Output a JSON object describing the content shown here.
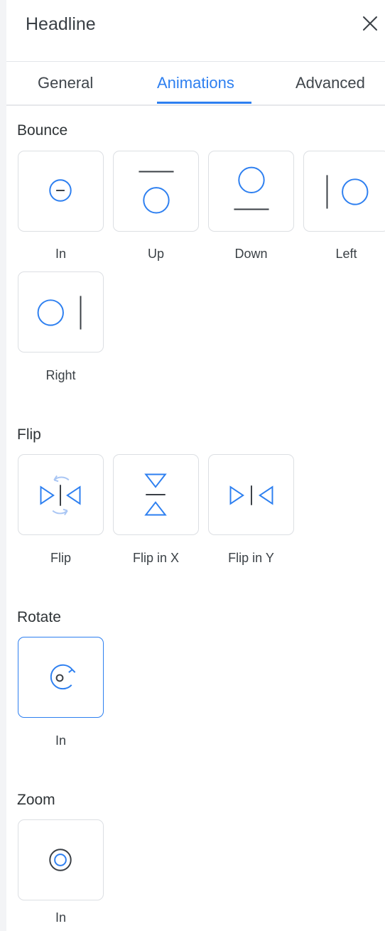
{
  "header": {
    "title": "Headline",
    "close_icon": "close-icon"
  },
  "tabs": [
    {
      "label": "General"
    },
    {
      "label": "Animations",
      "active": true
    },
    {
      "label": "Advanced"
    }
  ],
  "colors": {
    "accent": "#2d7ff0",
    "dark_icon": "#3a3f45",
    "border": "#dcdfe3"
  },
  "sections": [
    {
      "title": "Bounce",
      "items": [
        {
          "label": "In",
          "icon": "bounce-in-icon"
        },
        {
          "label": "Up",
          "icon": "bounce-up-icon"
        },
        {
          "label": "Down",
          "icon": "bounce-down-icon"
        },
        {
          "label": "Left",
          "icon": "bounce-left-icon"
        },
        {
          "label": "Right",
          "icon": "bounce-right-icon"
        }
      ]
    },
    {
      "title": "Flip",
      "items": [
        {
          "label": "Flip",
          "icon": "flip-icon"
        },
        {
          "label": "Flip in X",
          "icon": "flip-in-x-icon"
        },
        {
          "label": "Flip in Y",
          "icon": "flip-in-y-icon"
        }
      ]
    },
    {
      "title": "Rotate",
      "items": [
        {
          "label": "In",
          "icon": "rotate-in-icon",
          "selected": true
        }
      ]
    },
    {
      "title": "Zoom",
      "items": [
        {
          "label": "In",
          "icon": "zoom-in-icon"
        }
      ]
    }
  ]
}
